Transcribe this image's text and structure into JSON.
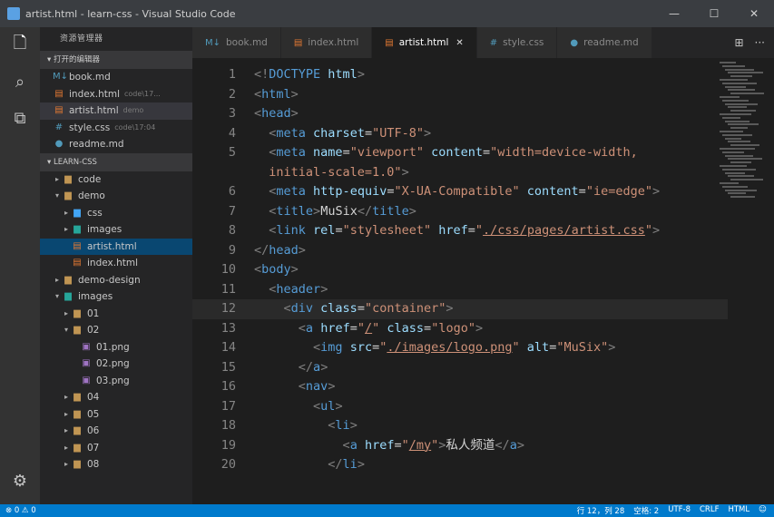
{
  "window": {
    "title": "artist.html - learn-css - Visual Studio Code",
    "controls": [
      "—",
      "☐",
      "✕"
    ]
  },
  "activity_bar": [
    {
      "name": "files-icon",
      "glyph": "🗋",
      "active": true
    },
    {
      "name": "search-icon",
      "glyph": "⌕",
      "active": false
    },
    {
      "name": "extensions-icon",
      "glyph": "⧉",
      "active": false
    }
  ],
  "activity_bottom": {
    "name": "settings-gear-icon",
    "glyph": "⚙"
  },
  "sidebar": {
    "header": "资源管理器",
    "open_editors_label": "▾ 打开的编辑器",
    "open_editors": [
      {
        "label": "book.md",
        "sub": "",
        "icon": "M↓",
        "color": "#519aba"
      },
      {
        "label": "index.html",
        "sub": "code\\17...",
        "icon": "▤",
        "color": "#e37933"
      },
      {
        "label": "artist.html",
        "sub": "demo",
        "icon": "▤",
        "color": "#e37933"
      },
      {
        "label": "style.css",
        "sub": "code\\17:04",
        "icon": "#",
        "color": "#519aba"
      },
      {
        "label": "readme.md",
        "sub": "",
        "icon": "●",
        "color": "#519aba"
      }
    ],
    "project_label": "▾ LEARN-CSS",
    "tree": [
      {
        "label": "code",
        "indent": 1,
        "twisty": "▸",
        "icon": "▆",
        "color": "#c09553"
      },
      {
        "label": "demo",
        "indent": 1,
        "twisty": "▾",
        "icon": "▆",
        "color": "#c09553"
      },
      {
        "label": "css",
        "indent": 2,
        "twisty": "▸",
        "icon": "▆",
        "color": "#42a5f5"
      },
      {
        "label": "images",
        "indent": 2,
        "twisty": "▸",
        "icon": "▆",
        "color": "#26a69a"
      },
      {
        "label": "artist.html",
        "indent": 2,
        "twisty": "",
        "icon": "▤",
        "color": "#e37933",
        "state": "selected"
      },
      {
        "label": "index.html",
        "indent": 2,
        "twisty": "",
        "icon": "▤",
        "color": "#e37933"
      },
      {
        "label": "demo-design",
        "indent": 1,
        "twisty": "▸",
        "icon": "▆",
        "color": "#c09553"
      },
      {
        "label": "images",
        "indent": 1,
        "twisty": "▾",
        "icon": "▆",
        "color": "#26a69a"
      },
      {
        "label": "01",
        "indent": 2,
        "twisty": "▸",
        "icon": "▆",
        "color": "#c09553"
      },
      {
        "label": "02",
        "indent": 2,
        "twisty": "▾",
        "icon": "▆",
        "color": "#c09553"
      },
      {
        "label": "01.png",
        "indent": 3,
        "twisty": "",
        "icon": "▣",
        "color": "#a074c4"
      },
      {
        "label": "02.png",
        "indent": 3,
        "twisty": "",
        "icon": "▣",
        "color": "#a074c4"
      },
      {
        "label": "03.png",
        "indent": 3,
        "twisty": "",
        "icon": "▣",
        "color": "#a074c4"
      },
      {
        "label": "04",
        "indent": 2,
        "twisty": "▸",
        "icon": "▆",
        "color": "#c09553"
      },
      {
        "label": "05",
        "indent": 2,
        "twisty": "▸",
        "icon": "▆",
        "color": "#c09553"
      },
      {
        "label": "06",
        "indent": 2,
        "twisty": "▸",
        "icon": "▆",
        "color": "#c09553"
      },
      {
        "label": "07",
        "indent": 2,
        "twisty": "▸",
        "icon": "▆",
        "color": "#c09553"
      },
      {
        "label": "08",
        "indent": 2,
        "twisty": "▸",
        "icon": "▆",
        "color": "#c09553"
      }
    ]
  },
  "tabs": [
    {
      "label": "book.md",
      "icon": "M↓",
      "color": "#519aba",
      "active": false
    },
    {
      "label": "index.html",
      "icon": "▤",
      "color": "#e37933",
      "active": false
    },
    {
      "label": "artist.html",
      "icon": "▤",
      "color": "#e37933",
      "active": true
    },
    {
      "label": "style.css",
      "icon": "#",
      "color": "#519aba",
      "active": false
    },
    {
      "label": "readme.md",
      "icon": "●",
      "color": "#519aba",
      "active": false
    }
  ],
  "tab_actions": [
    "⊞",
    "···"
  ],
  "editor": {
    "lines": [
      {
        "n": "1",
        "tokens": [
          [
            "p",
            "<!"
          ],
          [
            "t",
            "DOCTYPE"
          ],
          [
            "a",
            " html"
          ],
          [
            "p",
            ">"
          ]
        ]
      },
      {
        "n": "2",
        "tokens": [
          [
            "p",
            "<"
          ],
          [
            "t",
            "html"
          ],
          [
            "p",
            ">"
          ]
        ]
      },
      {
        "n": "3",
        "tokens": [
          [
            "p",
            "<"
          ],
          [
            "t",
            "head"
          ],
          [
            "p",
            ">"
          ]
        ]
      },
      {
        "n": "4",
        "tokens": [
          [
            "c",
            "  "
          ],
          [
            "p",
            "<"
          ],
          [
            "t",
            "meta"
          ],
          [
            "a",
            " charset"
          ],
          [
            "c",
            "="
          ],
          [
            "s",
            "\"UTF-8\""
          ],
          [
            "p",
            ">"
          ]
        ]
      },
      {
        "n": "5",
        "tokens": [
          [
            "c",
            "  "
          ],
          [
            "p",
            "<"
          ],
          [
            "t",
            "meta"
          ],
          [
            "a",
            " name"
          ],
          [
            "c",
            "="
          ],
          [
            "s",
            "\"viewport\""
          ],
          [
            "a",
            " content"
          ],
          [
            "c",
            "="
          ],
          [
            "s",
            "\"width=device-width,"
          ]
        ]
      },
      {
        "n": "",
        "tokens": [
          [
            "s",
            "  initial-scale=1.0\""
          ],
          [
            "p",
            ">"
          ]
        ]
      },
      {
        "n": "6",
        "tokens": [
          [
            "c",
            "  "
          ],
          [
            "p",
            "<"
          ],
          [
            "t",
            "meta"
          ],
          [
            "a",
            " http-equiv"
          ],
          [
            "c",
            "="
          ],
          [
            "s",
            "\"X-UA-Compatible\""
          ],
          [
            "a",
            " content"
          ],
          [
            "c",
            "="
          ],
          [
            "s",
            "\"ie=edge\""
          ],
          [
            "p",
            ">"
          ]
        ]
      },
      {
        "n": "7",
        "tokens": [
          [
            "c",
            "  "
          ],
          [
            "p",
            "<"
          ],
          [
            "t",
            "title"
          ],
          [
            "p",
            ">"
          ],
          [
            "c",
            "MuSix"
          ],
          [
            "p",
            "</"
          ],
          [
            "t",
            "title"
          ],
          [
            "p",
            ">"
          ]
        ]
      },
      {
        "n": "8",
        "tokens": [
          [
            "c",
            "  "
          ],
          [
            "p",
            "<"
          ],
          [
            "t",
            "link"
          ],
          [
            "a",
            " rel"
          ],
          [
            "c",
            "="
          ],
          [
            "s",
            "\"stylesheet\""
          ],
          [
            "a",
            " href"
          ],
          [
            "c",
            "="
          ],
          [
            "s",
            "\""
          ],
          [
            "su",
            "./css/pages/artist.css"
          ],
          [
            "s",
            "\""
          ],
          [
            "p",
            ">"
          ]
        ]
      },
      {
        "n": "9",
        "tokens": [
          [
            "p",
            "</"
          ],
          [
            "t",
            "head"
          ],
          [
            "p",
            ">"
          ]
        ]
      },
      {
        "n": "10",
        "tokens": [
          [
            "p",
            "<"
          ],
          [
            "t",
            "body"
          ],
          [
            "p",
            ">"
          ]
        ]
      },
      {
        "n": "11",
        "tokens": [
          [
            "c",
            "  "
          ],
          [
            "p",
            "<"
          ],
          [
            "t",
            "header"
          ],
          [
            "p",
            ">"
          ]
        ]
      },
      {
        "n": "12",
        "tokens": [
          [
            "c",
            "    "
          ],
          [
            "p",
            "<"
          ],
          [
            "t",
            "div"
          ],
          [
            "a",
            " class"
          ],
          [
            "c",
            "="
          ],
          [
            "s",
            "\"container\""
          ],
          [
            "p",
            ">"
          ]
        ],
        "current": true
      },
      {
        "n": "13",
        "tokens": [
          [
            "c",
            "      "
          ],
          [
            "p",
            "<"
          ],
          [
            "t",
            "a"
          ],
          [
            "a",
            " href"
          ],
          [
            "c",
            "="
          ],
          [
            "s",
            "\""
          ],
          [
            "su",
            "/"
          ],
          [
            "s",
            "\""
          ],
          [
            "a",
            " class"
          ],
          [
            "c",
            "="
          ],
          [
            "s",
            "\"logo\""
          ],
          [
            "p",
            ">"
          ]
        ]
      },
      {
        "n": "14",
        "tokens": [
          [
            "c",
            "        "
          ],
          [
            "p",
            "<"
          ],
          [
            "t",
            "img"
          ],
          [
            "a",
            " src"
          ],
          [
            "c",
            "="
          ],
          [
            "s",
            "\""
          ],
          [
            "su",
            "./images/logo.png"
          ],
          [
            "s",
            "\""
          ],
          [
            "a",
            " alt"
          ],
          [
            "c",
            "="
          ],
          [
            "s",
            "\"MuSix\""
          ],
          [
            "p",
            ">"
          ]
        ]
      },
      {
        "n": "15",
        "tokens": [
          [
            "c",
            "      "
          ],
          [
            "p",
            "</"
          ],
          [
            "t",
            "a"
          ],
          [
            "p",
            ">"
          ]
        ]
      },
      {
        "n": "16",
        "tokens": [
          [
            "c",
            "      "
          ],
          [
            "p",
            "<"
          ],
          [
            "t",
            "nav"
          ],
          [
            "p",
            ">"
          ]
        ]
      },
      {
        "n": "17",
        "tokens": [
          [
            "c",
            "        "
          ],
          [
            "p",
            "<"
          ],
          [
            "t",
            "ul"
          ],
          [
            "p",
            ">"
          ]
        ]
      },
      {
        "n": "18",
        "tokens": [
          [
            "c",
            "          "
          ],
          [
            "p",
            "<"
          ],
          [
            "t",
            "li"
          ],
          [
            "p",
            ">"
          ]
        ]
      },
      {
        "n": "19",
        "tokens": [
          [
            "c",
            "            "
          ],
          [
            "p",
            "<"
          ],
          [
            "t",
            "a"
          ],
          [
            "a",
            " href"
          ],
          [
            "c",
            "="
          ],
          [
            "s",
            "\""
          ],
          [
            "su",
            "/my"
          ],
          [
            "s",
            "\""
          ],
          [
            "p",
            ">"
          ],
          [
            "c",
            "私人频道"
          ],
          [
            "p",
            "</"
          ],
          [
            "t",
            "a"
          ],
          [
            "p",
            ">"
          ]
        ]
      },
      {
        "n": "20",
        "tokens": [
          [
            "c",
            "          "
          ],
          [
            "p",
            "</"
          ],
          [
            "t",
            "li"
          ],
          [
            "p",
            ">"
          ]
        ]
      }
    ]
  },
  "statusbar": {
    "left": "⊗ 0  ⚠ 0",
    "right": [
      "行 12，列 28",
      "空格: 2",
      "UTF-8",
      "CRLF",
      "HTML",
      "☺"
    ]
  }
}
